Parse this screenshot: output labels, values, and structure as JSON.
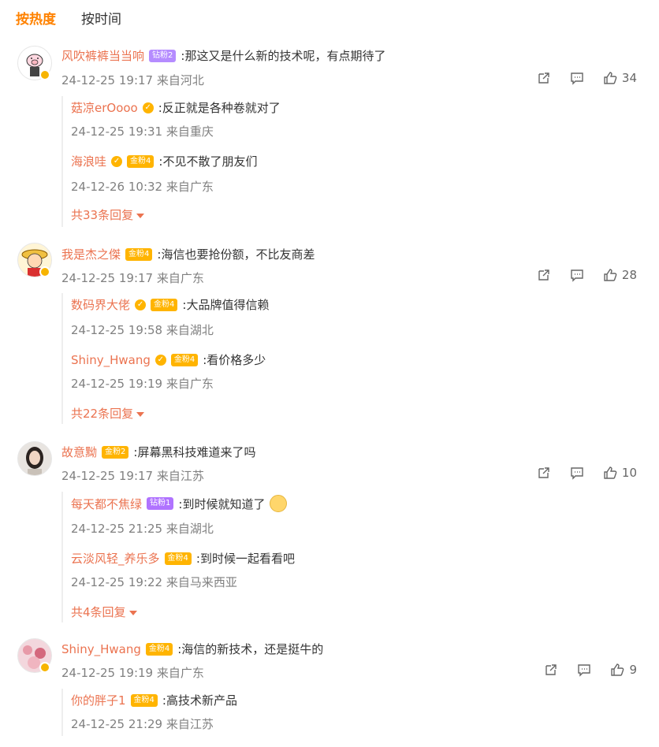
{
  "tabs": {
    "hot": "按热度",
    "time": "按时间"
  },
  "colors": {
    "accent": "#ff8200",
    "name": "#eb7350",
    "meta": "#808080"
  },
  "comments": [
    {
      "name": "风吹裤裤当当响",
      "badge": "钻粉2",
      "text": ":那这又是什么新的技术呢，有点期待了",
      "meta": "24-12-25 19:17 来自河北",
      "likes": "34",
      "replies": [
        {
          "name": "菇凉erOooo",
          "badge": "",
          "text": ":反正就是各种卷就对了",
          "meta": "24-12-25 19:31 来自重庆"
        },
        {
          "name": "海浪哇",
          "badge": "金粉4",
          "text": ":不见不散了朋友们",
          "meta": "24-12-26 10:32 来自广东"
        }
      ],
      "more": "共33条回复"
    },
    {
      "name": "我是杰之傑",
      "badge": "金粉4",
      "text": ":海信也要抢份额，不比友商差",
      "meta": "24-12-25 19:17 来自广东",
      "likes": "28",
      "replies": [
        {
          "name": "数码界大佬",
          "badge": "金粉4",
          "text": ":大品牌值得信赖",
          "meta": "24-12-25 19:58 来自湖北"
        },
        {
          "name": "Shiny_Hwang",
          "badge": "金粉4",
          "text": ":看价格多少",
          "meta": "24-12-25 19:19 来自广东"
        }
      ],
      "more": "共22条回复"
    },
    {
      "name": "故意黝",
      "badge": "金粉2",
      "text": ":屏幕黑科技难道来了吗",
      "meta": "24-12-25 19:17 来自江苏",
      "likes": "10",
      "replies": [
        {
          "name": "每天都不焦绿",
          "badge": "钻粉1",
          "text": ":到时候就知道了",
          "meta": "24-12-25 21:25 来自湖北"
        },
        {
          "name": "云淡风轻_养乐多",
          "badge": "金粉4",
          "text": ":到时候一起看看吧",
          "meta": "24-12-25 19:22 来自马来西亚"
        }
      ],
      "more": "共4条回复"
    },
    {
      "name": "Shiny_Hwang",
      "badge": "金粉4",
      "text": ":海信的新技术，还是挺牛的",
      "meta": "24-12-25 19:19 来自广东",
      "likes": "9",
      "replies": [
        {
          "name": "你的胖子1",
          "badge": "金粉4",
          "text": ":高技术新产品",
          "meta": "24-12-25 21:29 来自江苏"
        }
      ]
    }
  ]
}
